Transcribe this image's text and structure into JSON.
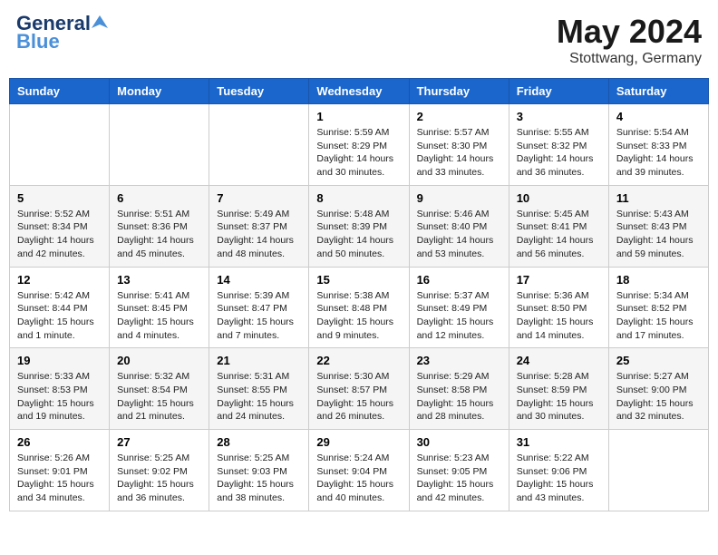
{
  "header": {
    "logo_line1": "General",
    "logo_line2": "Blue",
    "title": "May 2024",
    "location": "Stottwang, Germany"
  },
  "weekdays": [
    "Sunday",
    "Monday",
    "Tuesday",
    "Wednesday",
    "Thursday",
    "Friday",
    "Saturday"
  ],
  "weeks": [
    [
      {
        "day": "",
        "info": ""
      },
      {
        "day": "",
        "info": ""
      },
      {
        "day": "",
        "info": ""
      },
      {
        "day": "1",
        "info": "Sunrise: 5:59 AM\nSunset: 8:29 PM\nDaylight: 14 hours\nand 30 minutes."
      },
      {
        "day": "2",
        "info": "Sunrise: 5:57 AM\nSunset: 8:30 PM\nDaylight: 14 hours\nand 33 minutes."
      },
      {
        "day": "3",
        "info": "Sunrise: 5:55 AM\nSunset: 8:32 PM\nDaylight: 14 hours\nand 36 minutes."
      },
      {
        "day": "4",
        "info": "Sunrise: 5:54 AM\nSunset: 8:33 PM\nDaylight: 14 hours\nand 39 minutes."
      }
    ],
    [
      {
        "day": "5",
        "info": "Sunrise: 5:52 AM\nSunset: 8:34 PM\nDaylight: 14 hours\nand 42 minutes."
      },
      {
        "day": "6",
        "info": "Sunrise: 5:51 AM\nSunset: 8:36 PM\nDaylight: 14 hours\nand 45 minutes."
      },
      {
        "day": "7",
        "info": "Sunrise: 5:49 AM\nSunset: 8:37 PM\nDaylight: 14 hours\nand 48 minutes."
      },
      {
        "day": "8",
        "info": "Sunrise: 5:48 AM\nSunset: 8:39 PM\nDaylight: 14 hours\nand 50 minutes."
      },
      {
        "day": "9",
        "info": "Sunrise: 5:46 AM\nSunset: 8:40 PM\nDaylight: 14 hours\nand 53 minutes."
      },
      {
        "day": "10",
        "info": "Sunrise: 5:45 AM\nSunset: 8:41 PM\nDaylight: 14 hours\nand 56 minutes."
      },
      {
        "day": "11",
        "info": "Sunrise: 5:43 AM\nSunset: 8:43 PM\nDaylight: 14 hours\nand 59 minutes."
      }
    ],
    [
      {
        "day": "12",
        "info": "Sunrise: 5:42 AM\nSunset: 8:44 PM\nDaylight: 15 hours\nand 1 minute."
      },
      {
        "day": "13",
        "info": "Sunrise: 5:41 AM\nSunset: 8:45 PM\nDaylight: 15 hours\nand 4 minutes."
      },
      {
        "day": "14",
        "info": "Sunrise: 5:39 AM\nSunset: 8:47 PM\nDaylight: 15 hours\nand 7 minutes."
      },
      {
        "day": "15",
        "info": "Sunrise: 5:38 AM\nSunset: 8:48 PM\nDaylight: 15 hours\nand 9 minutes."
      },
      {
        "day": "16",
        "info": "Sunrise: 5:37 AM\nSunset: 8:49 PM\nDaylight: 15 hours\nand 12 minutes."
      },
      {
        "day": "17",
        "info": "Sunrise: 5:36 AM\nSunset: 8:50 PM\nDaylight: 15 hours\nand 14 minutes."
      },
      {
        "day": "18",
        "info": "Sunrise: 5:34 AM\nSunset: 8:52 PM\nDaylight: 15 hours\nand 17 minutes."
      }
    ],
    [
      {
        "day": "19",
        "info": "Sunrise: 5:33 AM\nSunset: 8:53 PM\nDaylight: 15 hours\nand 19 minutes."
      },
      {
        "day": "20",
        "info": "Sunrise: 5:32 AM\nSunset: 8:54 PM\nDaylight: 15 hours\nand 21 minutes."
      },
      {
        "day": "21",
        "info": "Sunrise: 5:31 AM\nSunset: 8:55 PM\nDaylight: 15 hours\nand 24 minutes."
      },
      {
        "day": "22",
        "info": "Sunrise: 5:30 AM\nSunset: 8:57 PM\nDaylight: 15 hours\nand 26 minutes."
      },
      {
        "day": "23",
        "info": "Sunrise: 5:29 AM\nSunset: 8:58 PM\nDaylight: 15 hours\nand 28 minutes."
      },
      {
        "day": "24",
        "info": "Sunrise: 5:28 AM\nSunset: 8:59 PM\nDaylight: 15 hours\nand 30 minutes."
      },
      {
        "day": "25",
        "info": "Sunrise: 5:27 AM\nSunset: 9:00 PM\nDaylight: 15 hours\nand 32 minutes."
      }
    ],
    [
      {
        "day": "26",
        "info": "Sunrise: 5:26 AM\nSunset: 9:01 PM\nDaylight: 15 hours\nand 34 minutes."
      },
      {
        "day": "27",
        "info": "Sunrise: 5:25 AM\nSunset: 9:02 PM\nDaylight: 15 hours\nand 36 minutes."
      },
      {
        "day": "28",
        "info": "Sunrise: 5:25 AM\nSunset: 9:03 PM\nDaylight: 15 hours\nand 38 minutes."
      },
      {
        "day": "29",
        "info": "Sunrise: 5:24 AM\nSunset: 9:04 PM\nDaylight: 15 hours\nand 40 minutes."
      },
      {
        "day": "30",
        "info": "Sunrise: 5:23 AM\nSunset: 9:05 PM\nDaylight: 15 hours\nand 42 minutes."
      },
      {
        "day": "31",
        "info": "Sunrise: 5:22 AM\nSunset: 9:06 PM\nDaylight: 15 hours\nand 43 minutes."
      },
      {
        "day": "",
        "info": ""
      }
    ]
  ]
}
